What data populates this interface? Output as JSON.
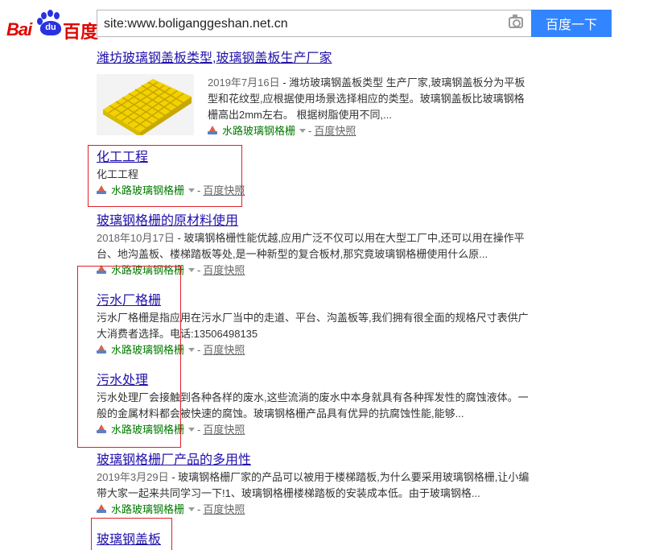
{
  "header": {
    "logo": {
      "bai": "Bai",
      "du": "du",
      "baidu_cn": "百度"
    },
    "search": {
      "query": "site:www.boliganggeshan.net.cn"
    },
    "search_button": "百度一下"
  },
  "results": [
    {
      "title": "潍坊玻璃钢盖板类型,玻璃钢盖板生产厂家",
      "date": "2019年7月16日",
      "abstract": " - 潍坊玻璃钢盖板类型 生产厂家,玻璃钢盖板分为平板型和花纹型,应根据使用场景选择相应的类型。玻璃钢盖板比玻璃钢格栅高出2mm左右。 根据树脂使用不同,...",
      "site": "水路玻璃钢格栅",
      "snapshot": "百度快照"
    },
    {
      "title": "化工工程",
      "date": "",
      "abstract": "化工工程",
      "site": "水路玻璃钢格栅",
      "snapshot": "百度快照"
    },
    {
      "title": "玻璃钢格栅的原材料使用",
      "date": "2018年10月17日",
      "abstract": " - 玻璃钢格栅性能优越,应用广泛不仅可以用在大型工厂中,还可以用在操作平台、地沟盖板、楼梯踏板等处,是一种新型的复合板材,那究竟玻璃钢格栅使用什么原...",
      "site": "水路玻璃钢格栅",
      "snapshot": "百度快照"
    },
    {
      "title": "污水厂格栅",
      "date": "",
      "abstract": "污水厂格栅是指应用在污水厂当中的走道、平台、沟盖板等,我们拥有很全面的规格尺寸表供广大消费者选择。电话:13506498135",
      "site": "水路玻璃钢格栅",
      "snapshot": "百度快照"
    },
    {
      "title": "污水处理",
      "date": "",
      "abstract": "污水处理厂会接触到各种各样的废水,这些流淌的废水中本身就具有各种挥发性的腐蚀液体。一般的金属材料都会被快速的腐蚀。玻璃钢格栅产品具有优异的抗腐蚀性能,能够...",
      "site": "水路玻璃钢格栅",
      "snapshot": "百度快照"
    },
    {
      "title": "玻璃钢格栅厂产品的多用性",
      "date": "2019年3月29日",
      "abstract": " - 玻璃钢格栅厂家的产品可以被用于楼梯踏板,为什么要采用玻璃钢格栅,让小编带大家一起来共同学习一下!1、玻璃钢格栅楼梯踏板的安装成本低。由于玻璃钢格...",
      "site": "水路玻璃钢格栅",
      "snapshot": "百度快照"
    },
    {
      "title": "玻璃钢盖板",
      "date": "",
      "abstract": "",
      "site": "",
      "snapshot": ""
    }
  ],
  "colors": {
    "link": "#2011aa",
    "site": "#007a00",
    "button": "#3385ff",
    "highlight_box": "#e0202a",
    "logo_red": "#e10601",
    "logo_blue": "#2932e1"
  },
  "icons": [
    "camera-icon",
    "site-favicon-icon",
    "dropdown-arrow-icon",
    "grating-thumbnail"
  ]
}
